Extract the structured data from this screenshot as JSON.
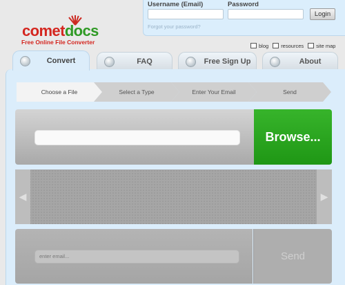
{
  "logo": {
    "word_part1": "comet",
    "word_part2": "docs",
    "tagline": "Free Online File Converter"
  },
  "login": {
    "username_label": "Username (Email)",
    "password_label": "Password",
    "username_value": "",
    "password_value": "",
    "login_button": "Login",
    "forgot_link": "Forgot your password?"
  },
  "util_links": [
    {
      "label": "blog",
      "icon": "monitor-icon"
    },
    {
      "label": "resources",
      "icon": "page-icon"
    },
    {
      "label": "site map",
      "icon": "sitemap-icon"
    }
  ],
  "tabs": [
    {
      "label": "Convert",
      "icon": "convert-icon",
      "active": true
    },
    {
      "label": "FAQ",
      "icon": "question-icon",
      "active": false
    },
    {
      "label": "Free Sign Up",
      "icon": "signup-icon",
      "active": false
    },
    {
      "label": "About",
      "icon": "info-icon",
      "active": false
    }
  ],
  "steps": [
    "Choose a File",
    "Select a Type",
    "Enter Your Email",
    "Send"
  ],
  "upload": {
    "file_value": "",
    "browse_label": "Browse..."
  },
  "carousel": {
    "left_arrow": "◀",
    "right_arrow": "▶"
  },
  "email": {
    "placeholder": "enter email...",
    "send_label": "Send"
  },
  "colors": {
    "brand_red": "#d4261f",
    "brand_green": "#2f9a25",
    "browse_green": "#37b42b",
    "panel_blue": "#dbedfb"
  }
}
